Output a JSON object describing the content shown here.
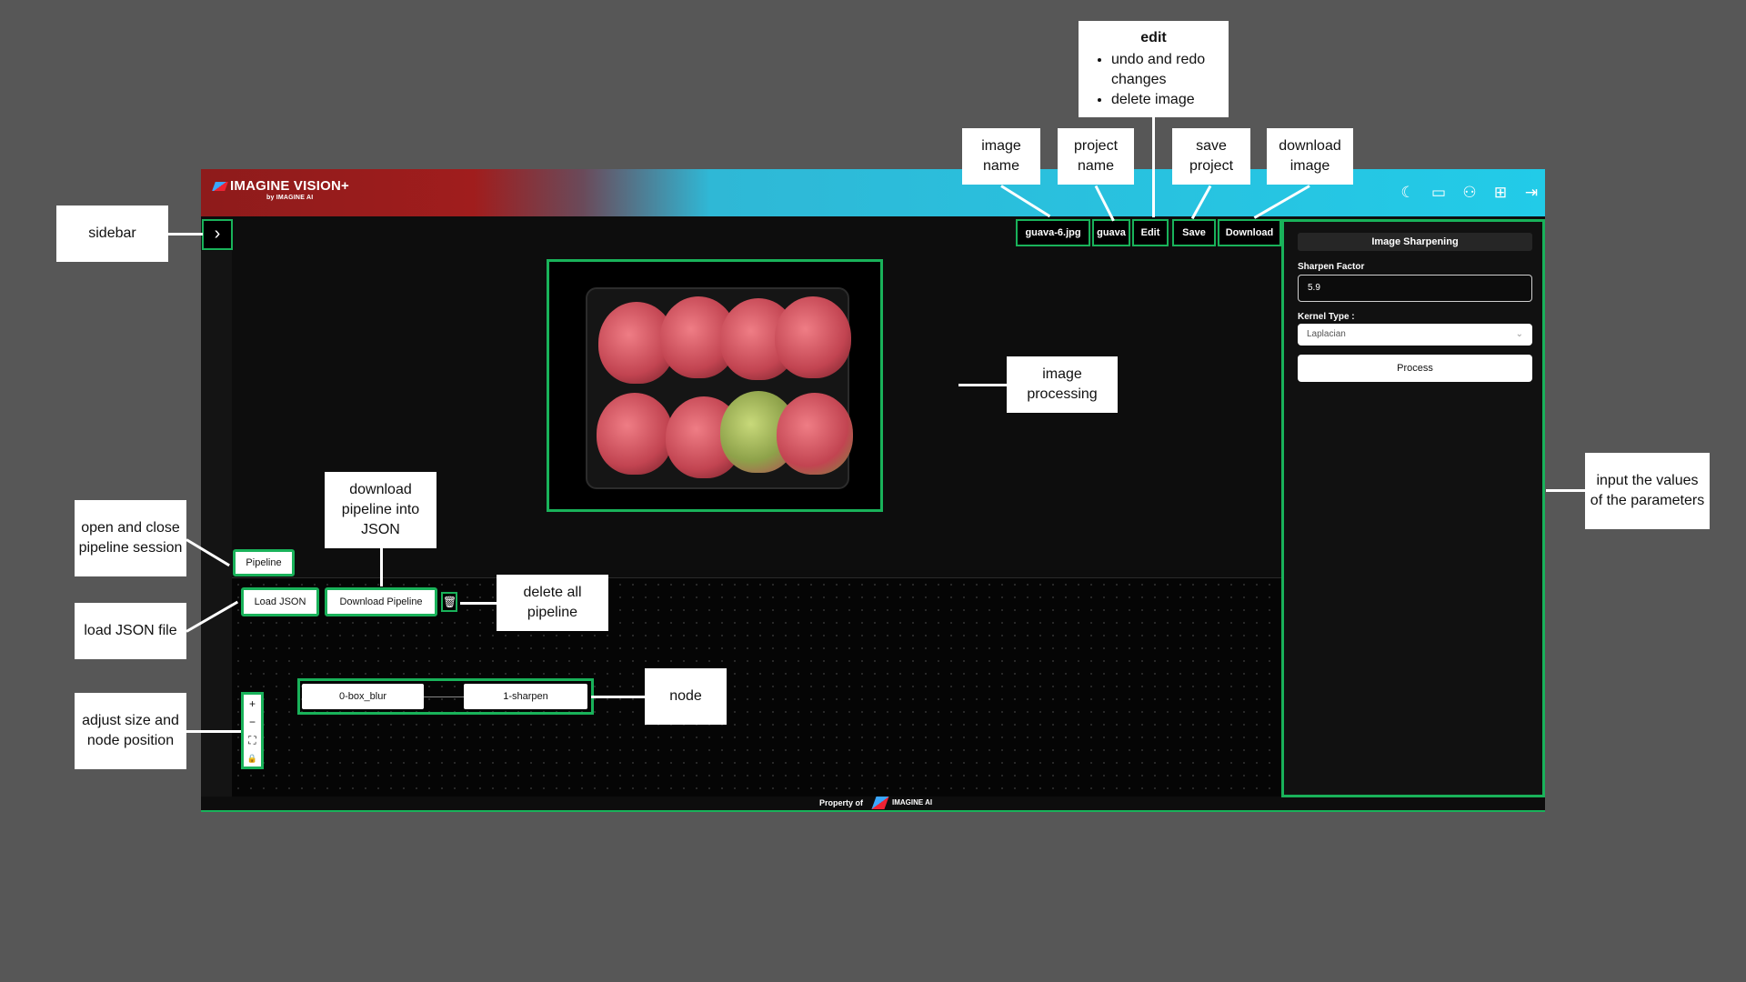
{
  "app": {
    "brand": "IMAGINE VISION+",
    "brand_sub": "by IMAGINE AI",
    "header_icons": [
      "moon-icon",
      "window-icon",
      "users-icon",
      "book-icon",
      "logout-icon"
    ]
  },
  "toolbar": {
    "image_name": "guava-6.jpg",
    "project_name": "guava",
    "edit_label": "Edit",
    "save_label": "Save",
    "download_label": "Download"
  },
  "pipeline": {
    "toggle_label": "Pipeline",
    "load_json_label": "Load JSON",
    "download_pipeline_label": "Download Pipeline",
    "nodes": [
      "0-box_blur",
      "1-sharpen"
    ]
  },
  "flow_controls": [
    "+",
    "−",
    "⛶",
    "🔒"
  ],
  "footer": {
    "property_text": "Property of",
    "brand": "IMAGINE AI"
  },
  "params": {
    "title": "Image Sharpening",
    "sharpen_label": "Sharpen Factor",
    "sharpen_value": "5.9",
    "kernel_label": "Kernel Type :",
    "kernel_value": "Laplacian",
    "process_label": "Process"
  },
  "annotations": {
    "image_name": "image name",
    "project_name": "project name",
    "edit_title": "edit",
    "edit_items": [
      "undo and redo changes",
      "delete image"
    ],
    "save_project": "save project",
    "download_image": "download image",
    "sidebar": "sidebar",
    "image_processing": "image processing",
    "input_values": "input the values of the parameters",
    "open_close_pipeline": "open and close pipeline session",
    "download_pipeline": "download pipeline into JSON",
    "load_json": "load JSON file",
    "delete_pipeline": "delete all pipeline",
    "adjust": "adjust size and node position",
    "node": "node"
  },
  "colors": {
    "background": "#575757",
    "highlight": "#19b25a",
    "header_red": "#a01d1d",
    "header_cyan": "#22cbe8"
  }
}
